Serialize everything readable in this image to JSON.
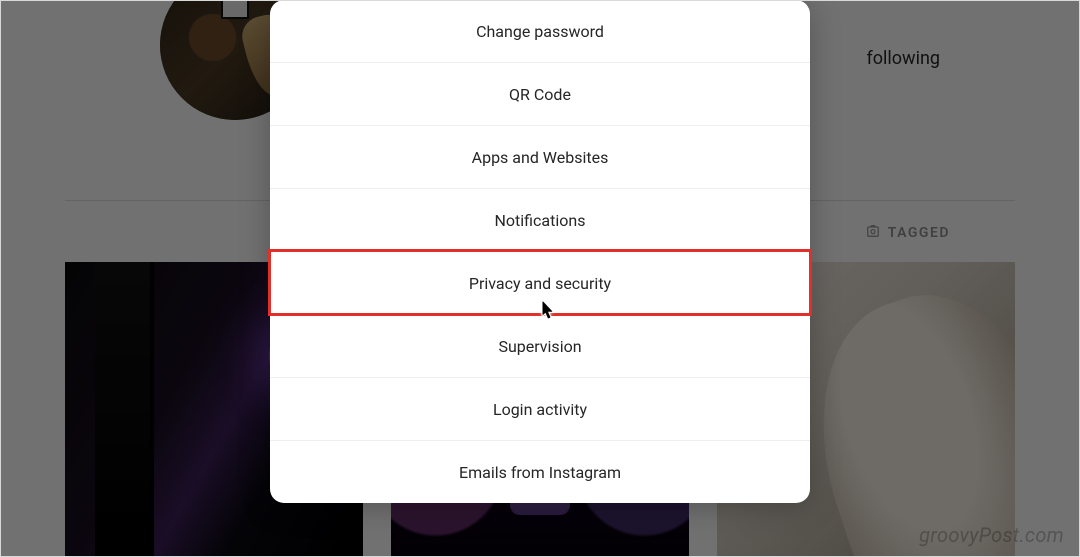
{
  "profile": {
    "following_label": "following",
    "tagged_label": "TAGGED"
  },
  "modal": {
    "items": [
      {
        "key": "change-password",
        "label": "Change password"
      },
      {
        "key": "qr-code",
        "label": "QR Code"
      },
      {
        "key": "apps-websites",
        "label": "Apps and Websites"
      },
      {
        "key": "notifications",
        "label": "Notifications"
      },
      {
        "key": "privacy-security",
        "label": "Privacy and security"
      },
      {
        "key": "supervision",
        "label": "Supervision"
      },
      {
        "key": "login-activity",
        "label": "Login activity"
      },
      {
        "key": "emails-instagram",
        "label": "Emails from Instagram"
      }
    ],
    "highlighted_key": "privacy-security",
    "cursor_on_key": "privacy-security"
  },
  "annotation": {
    "highlight_color": "#e1302a"
  },
  "watermark": "groovyPost.com"
}
